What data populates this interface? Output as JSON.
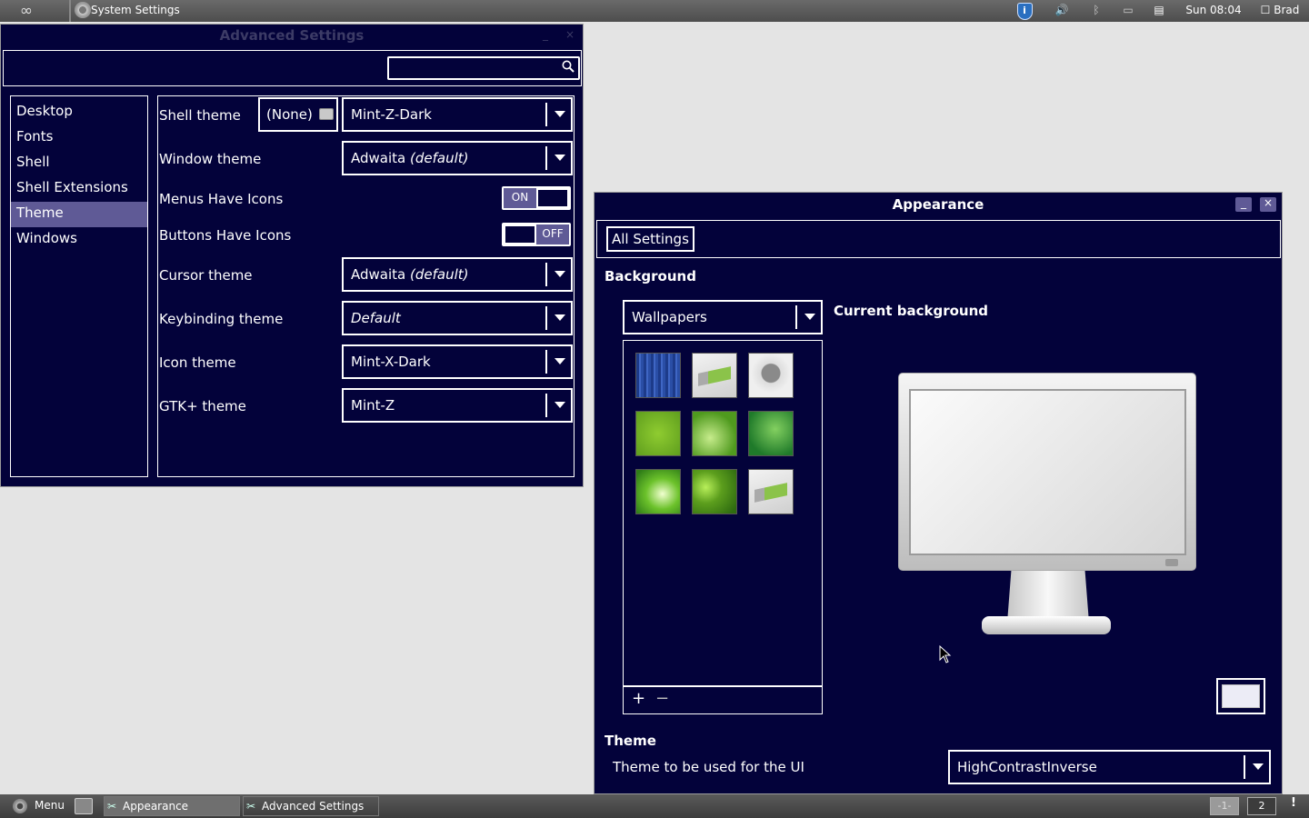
{
  "top_panel": {
    "logo": "∞",
    "app_name": "System Settings",
    "tray": {
      "info_icon": "i",
      "volume_icon": "🔊",
      "bluetooth_icon": "ᛒ",
      "clock": "Sun 08:04",
      "user": "Brad"
    }
  },
  "advanced_settings": {
    "title": "Advanced Settings",
    "minimize": "_",
    "close": "×",
    "search": {
      "value": "",
      "placeholder": ""
    },
    "sidebar": {
      "items": [
        "Desktop",
        "Fonts",
        "Shell",
        "Shell Extensions",
        "Theme",
        "Windows"
      ],
      "selected": "Theme"
    },
    "rows": {
      "shell_theme": {
        "label": "Shell theme",
        "file_button": "(None)",
        "value": "Mint-Z-Dark"
      },
      "window_theme": {
        "label": "Window theme",
        "value": "Adwaita",
        "value_suffix": "(default)"
      },
      "menus_have_icons": {
        "label": "Menus Have Icons",
        "state": "ON"
      },
      "buttons_have_icons": {
        "label": "Buttons Have Icons",
        "state": "OFF"
      },
      "cursor_theme": {
        "label": "Cursor theme",
        "value": "Adwaita",
        "value_suffix": "(default)"
      },
      "keybinding_theme": {
        "label": "Keybinding theme",
        "value": "Default"
      },
      "icon_theme": {
        "label": "Icon theme",
        "value": "Mint-X-Dark"
      },
      "gtk_theme": {
        "label": "GTK+ theme",
        "value": "Mint-Z"
      }
    }
  },
  "appearance": {
    "title": "Appearance",
    "minimize": "_",
    "close": "×",
    "all_settings": "All Settings",
    "background_heading": "Background",
    "wallpaper_source": "Wallpapers",
    "current_background": "Current background",
    "add": "+",
    "remove": "−",
    "theme_heading": "Theme",
    "theme_label": "Theme to be used for the UI",
    "theme_value": "HighContrastInverse",
    "thumbnails": [
      "blue-lines",
      "mint-logo",
      "mint-sketch",
      "green-texture",
      "green-leaf",
      "green-swirl",
      "green-rays",
      "green-bokeh",
      "mint-logo"
    ]
  },
  "bottom_panel": {
    "menu": "Menu",
    "tasks": [
      "Appearance",
      "Advanced Settings"
    ],
    "workspaces": [
      "-1-",
      "2"
    ],
    "notif": "!"
  },
  "colors": {
    "window_bg": "#03023a",
    "selection": "#5f5a96",
    "text": "#ffffff"
  }
}
